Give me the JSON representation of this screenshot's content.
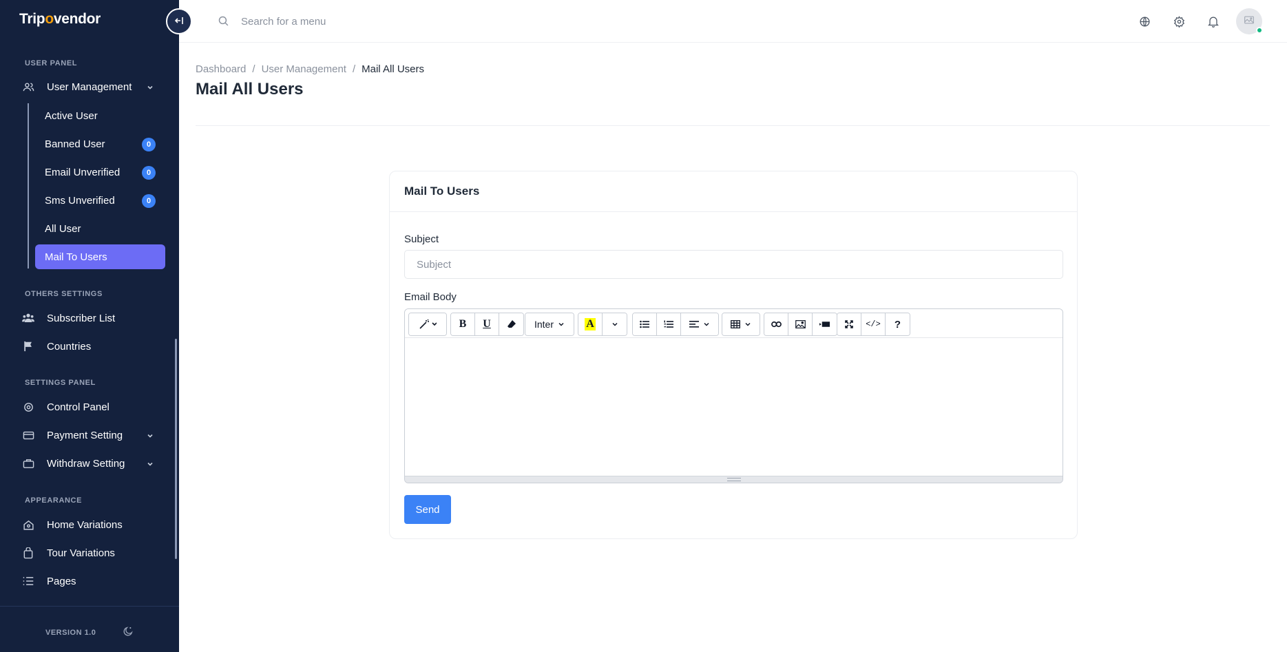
{
  "brand": {
    "name_prefix": "Trip",
    "name_o": "o",
    "name_suffix": "vendor"
  },
  "sidebar": {
    "collapse_icon": "collapse-left-icon",
    "sections": {
      "user_panel": "USER PANEL",
      "others_settings": "OTHERS SETTINGS",
      "settings_panel": "SETTINGS PANEL",
      "appearance": "APPEARANCE"
    },
    "user_management": {
      "label": "User Management",
      "icon": "users-icon",
      "children": [
        {
          "label": "Active User"
        },
        {
          "label": "Banned User",
          "badge": "0"
        },
        {
          "label": "Email Unverified",
          "badge": "0"
        },
        {
          "label": "Sms Unverified",
          "badge": "0"
        },
        {
          "label": "All User"
        },
        {
          "label": "Mail To Users",
          "active": true
        }
      ]
    },
    "others": [
      {
        "label": "Subscriber List",
        "icon": "users-group-icon"
      },
      {
        "label": "Countries",
        "icon": "flag-icon"
      }
    ],
    "settings": [
      {
        "label": "Control Panel",
        "icon": "gear-icon"
      },
      {
        "label": "Payment Setting",
        "icon": "wallet-icon"
      },
      {
        "label": "Withdraw Setting",
        "icon": "briefcase-icon"
      }
    ],
    "appearance": [
      {
        "label": "Home Variations",
        "icon": "home-icon"
      },
      {
        "label": "Tour Variations",
        "icon": "bag-icon"
      },
      {
        "label": "Pages",
        "icon": "list-icon"
      }
    ],
    "footer": {
      "version": "VERSION 1.0",
      "theme_icon": "moon-icon"
    }
  },
  "header": {
    "search_placeholder": "Search for a menu",
    "icons": [
      "globe-icon",
      "gear-icon",
      "bell-icon",
      "avatar"
    ]
  },
  "breadcrumb": [
    "Dashboard",
    "User Management",
    "Mail All Users"
  ],
  "page_title": "Mail All Users",
  "card": {
    "title": "Mail To Users",
    "subject_label": "Subject",
    "subject_placeholder": "Subject",
    "subject_value": "",
    "body_label": "Email Body",
    "font_name": "Inter",
    "highlight_color": "#ffff00",
    "send_label": "Send"
  },
  "colors": {
    "sidebar_bg": "#14213d",
    "active_item": "#6c6cf5",
    "primary": "#3b82f6",
    "online": "#10b981"
  }
}
